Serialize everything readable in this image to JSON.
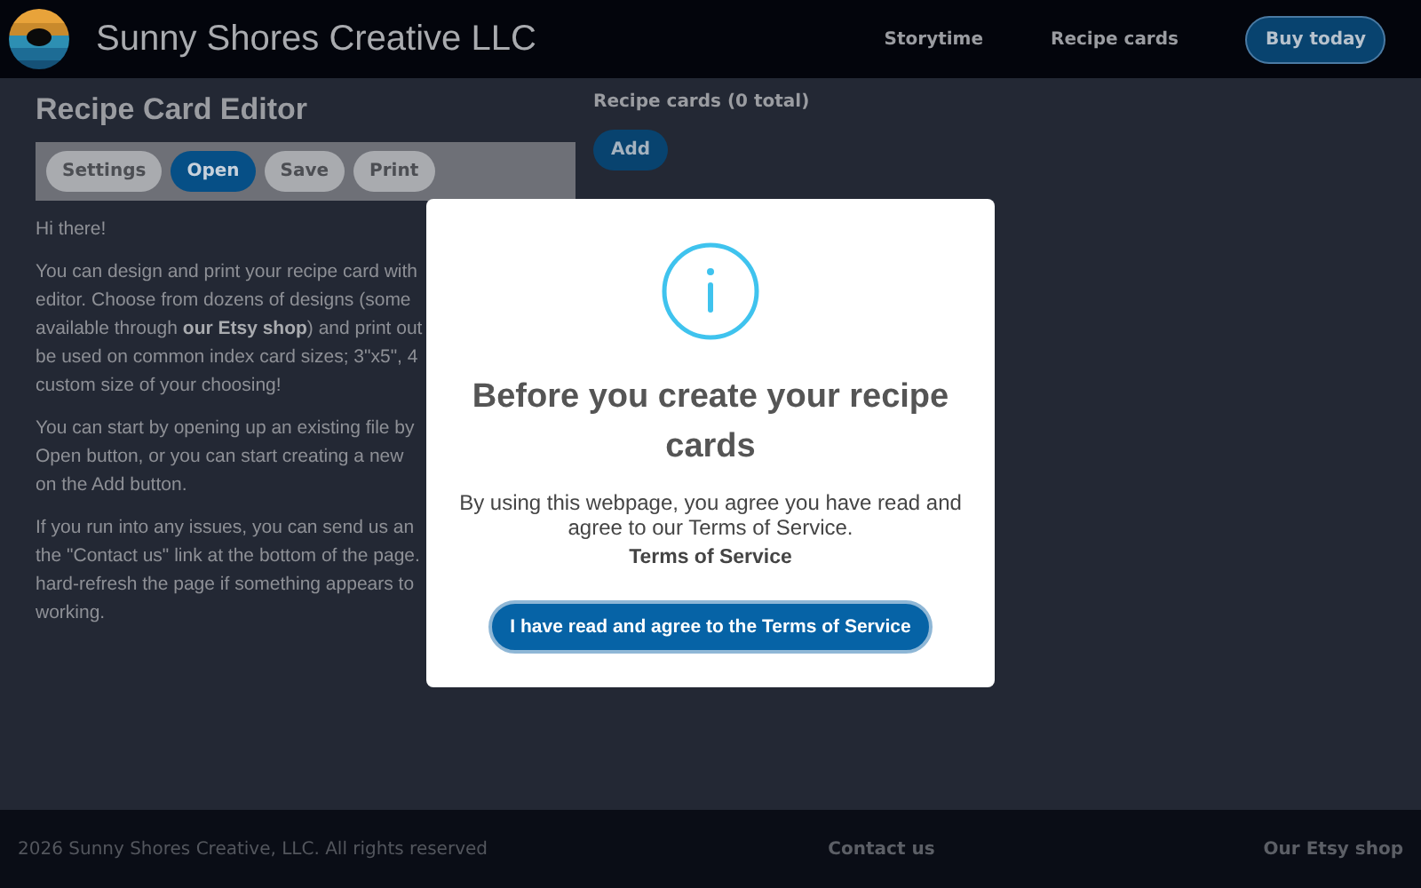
{
  "header": {
    "brand": "Sunny Shores Creative LLC",
    "nav": [
      {
        "label": "Storytime",
        "kind": "link"
      },
      {
        "label": "Recipe cards",
        "kind": "link"
      },
      {
        "label": "Buy today",
        "kind": "button"
      }
    ]
  },
  "editor": {
    "title": "Recipe Card Editor",
    "toolbar": [
      {
        "label": "Settings",
        "selected": false
      },
      {
        "label": "Open",
        "selected": true
      },
      {
        "label": "Save",
        "selected": false
      },
      {
        "label": "Print",
        "selected": false
      }
    ],
    "paragraphs": [
      [
        "Hi there!"
      ],
      [
        "You can design and print your recipe card with",
        "editor. Choose from dozens of designs (some",
        "available through **our Etsy shop**) and print out",
        "be used on common index card sizes; 3\"x5\", 4",
        "custom size of your choosing!"
      ],
      [
        "You can start by opening up an existing file by",
        "Open button, or you can start creating a new",
        "on the Add button."
      ],
      [
        "If you run into any issues, you can send us an",
        "the \"Contact us\" link at the bottom of the page.",
        "hard-refresh the page if something appears to",
        "working."
      ]
    ]
  },
  "cards": {
    "heading": "Recipe cards (0 total)",
    "add_button": "Add"
  },
  "dialog": {
    "title": "Before you create your recipe cards",
    "body": "By using this webpage, you agree you have read and agree to our Terms of Service.",
    "link": "Terms of Service",
    "confirm": "I have read and agree to the Terms of Service"
  },
  "footer": {
    "copyright": "2026 Sunny Shores Creative, LLC. All rights reserved",
    "links": [
      "Contact us",
      "Our Etsy shop"
    ]
  }
}
